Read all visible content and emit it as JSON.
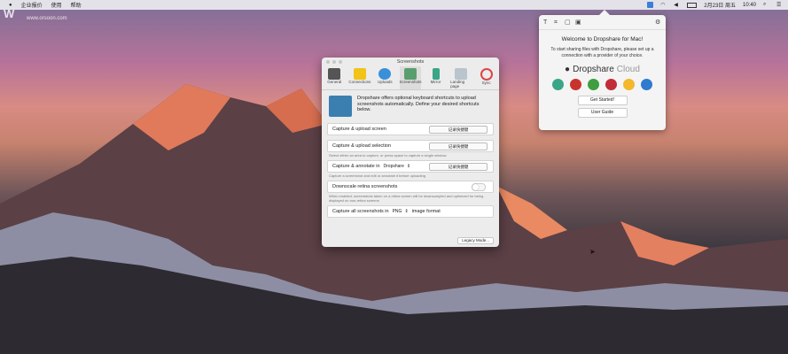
{
  "menubar": {
    "items": [
      "企业报价",
      "使用",
      "帮助"
    ],
    "date": "2月23日 周五",
    "time": "10:40"
  },
  "watermark": {
    "brand": "W",
    "site": "www.orsoon.com"
  },
  "popover": {
    "title": "Welcome to Dropshare for Mac!",
    "description": "To start sharing files with Dropshare, please set up a connection with a provider of your choice.",
    "logo_text": "Dropshare",
    "logo_suffix": "Cloud",
    "get_started": "Get Started!",
    "user_guide": "User Guide"
  },
  "prefs": {
    "title": "Screenshots",
    "tabs": [
      "General",
      "Connections",
      "Uploads",
      "Screenshots",
      "Mirror",
      "Landing page",
      "Sync"
    ],
    "intro": "Dropshare offers optional keyboard shortcuts to upload screenshots automatically. Define your desired shortcuts below.",
    "rows": {
      "capture_screen": "Capture & upload screen",
      "capture_selection": "Capture & upload selection",
      "capture_selection_hint": "Select either an area to capture, or press space to capture a single window",
      "capture_annotate": "Capture & annotate in",
      "annotate_app": "Dropshare",
      "capture_annotate_hint": "Capture a screenshot and edit or annotate it before uploading",
      "downscale": "Downscale retina screenshots",
      "downscale_hint": "When enabled, screenshots taken on a retina screen will be downsampled and optimized for being displayed on non-retina screens",
      "capture_all": "Capture all screenshots in",
      "format": "PNG",
      "format_suffix": "image format"
    },
    "shortcut_placeholder": "记录快捷键",
    "legacy_button": "Legacy Mode..."
  }
}
